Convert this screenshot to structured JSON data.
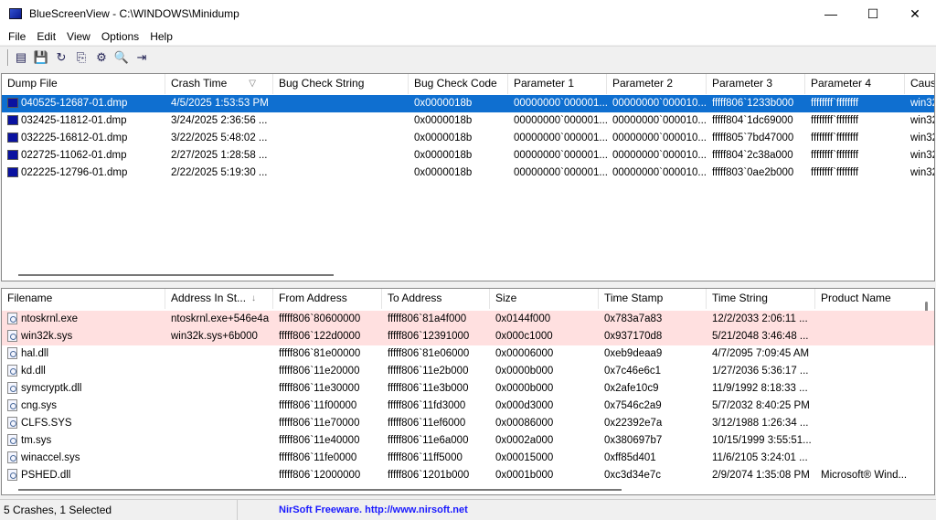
{
  "window": {
    "title": "BlueScreenView  -  C:\\WINDOWS\\Minidump",
    "minimize": "—",
    "maximize": "☐",
    "close": "✕"
  },
  "menu": [
    "File",
    "Edit",
    "View",
    "Options",
    "Help"
  ],
  "toolbar": [
    {
      "icon": "properties-icon",
      "glyph": "▤"
    },
    {
      "icon": "save-icon",
      "glyph": "💾"
    },
    {
      "icon": "refresh-icon",
      "glyph": "↻"
    },
    {
      "icon": "copy-icon",
      "glyph": "⎘"
    },
    {
      "icon": "advanced-options-icon",
      "glyph": "⚙"
    },
    {
      "icon": "find-icon",
      "glyph": "🔍"
    },
    {
      "icon": "exit-icon",
      "glyph": "⇥"
    }
  ],
  "crashes": {
    "columns": [
      "Dump File",
      "Crash Time",
      "Bug Check String",
      "Bug Check Code",
      "Parameter 1",
      "Parameter 2",
      "Parameter 3",
      "Parameter 4",
      "Caus"
    ],
    "sort_indicator": "▽",
    "rows": [
      [
        "040525-12687-01.dmp",
        "4/5/2025 1:53:53 PM",
        "",
        "0x0000018b",
        "00000000`000001...",
        "00000000`000010...",
        "fffff806`1233b000",
        "ffffffff`ffffffff",
        "win32"
      ],
      [
        "032425-11812-01.dmp",
        "3/24/2025 2:36:56 ...",
        "",
        "0x0000018b",
        "00000000`000001...",
        "00000000`000010...",
        "fffff804`1dc69000",
        "ffffffff`ffffffff",
        "win32"
      ],
      [
        "032225-16812-01.dmp",
        "3/22/2025 5:48:02 ...",
        "",
        "0x0000018b",
        "00000000`000001...",
        "00000000`000010...",
        "fffff805`7bd47000",
        "ffffffff`ffffffff",
        "win32"
      ],
      [
        "022725-11062-01.dmp",
        "2/27/2025 1:28:58 ...",
        "",
        "0x0000018b",
        "00000000`000001...",
        "00000000`000010...",
        "fffff804`2c38a000",
        "ffffffff`ffffffff",
        "win32"
      ],
      [
        "022225-12796-01.dmp",
        "2/22/2025 5:19:30 ...",
        "",
        "0x0000018b",
        "00000000`000001...",
        "00000000`000010...",
        "fffff803`0ae2b000",
        "ffffffff`ffffffff",
        "win32"
      ]
    ]
  },
  "drivers": {
    "columns": [
      "Filename",
      "Address In St...",
      "From Address",
      "To Address",
      "Size",
      "Time Stamp",
      "Time String",
      "Product Name"
    ],
    "sort_indicator": "↓",
    "rows": [
      [
        "ntoskrnl.exe",
        "ntoskrnl.exe+546e4a",
        "fffff806`80600000",
        "fffff806`81a4f000",
        "0x0144f000",
        "0x783a7a83",
        "12/2/2033 2:06:11 ...",
        ""
      ],
      [
        "win32k.sys",
        "win32k.sys+6b000",
        "fffff806`122d0000",
        "fffff806`12391000",
        "0x000c1000",
        "0x937170d8",
        "5/21/2048 3:46:48 ...",
        ""
      ],
      [
        "hal.dll",
        "",
        "fffff806`81e00000",
        "fffff806`81e06000",
        "0x00006000",
        "0xeb9deaa9",
        "4/7/2095 7:09:45 AM",
        ""
      ],
      [
        "kd.dll",
        "",
        "fffff806`11e20000",
        "fffff806`11e2b000",
        "0x0000b000",
        "0x7c46e6c1",
        "1/27/2036 5:36:17 ...",
        ""
      ],
      [
        "symcryptk.dll",
        "",
        "fffff806`11e30000",
        "fffff806`11e3b000",
        "0x0000b000",
        "0x2afe10c9",
        "11/9/1992 8:18:33 ...",
        ""
      ],
      [
        "cng.sys",
        "",
        "fffff806`11f00000",
        "fffff806`11fd3000",
        "0x000d3000",
        "0x7546c2a9",
        "5/7/2032 8:40:25 PM",
        ""
      ],
      [
        "CLFS.SYS",
        "",
        "fffff806`11e70000",
        "fffff806`11ef6000",
        "0x00086000",
        "0x22392e7a",
        "3/12/1988 1:26:34 ...",
        ""
      ],
      [
        "tm.sys",
        "",
        "fffff806`11e40000",
        "fffff806`11e6a000",
        "0x0002a000",
        "0x380697b7",
        "10/15/1999 3:55:51...",
        ""
      ],
      [
        "winaccel.sys",
        "",
        "fffff806`11fe0000",
        "fffff806`11ff5000",
        "0x00015000",
        "0xff85d401",
        "11/6/2105 3:24:01 ...",
        ""
      ],
      [
        "PSHED.dll",
        "",
        "fffff806`12000000",
        "fffff806`1201b000",
        "0x0001b000",
        "0xc3d34e7c",
        "2/9/2074 1:35:08 PM",
        "Microsoft® Wind..."
      ]
    ]
  },
  "status": {
    "summary": "5 Crashes, 1 Selected",
    "credit": "NirSoft Freeware.  http://www.nirsoft.net"
  },
  "colors": {
    "selected": "#0f6fd0",
    "highlight": "#ffe0e0",
    "link": "#1a1aff"
  }
}
